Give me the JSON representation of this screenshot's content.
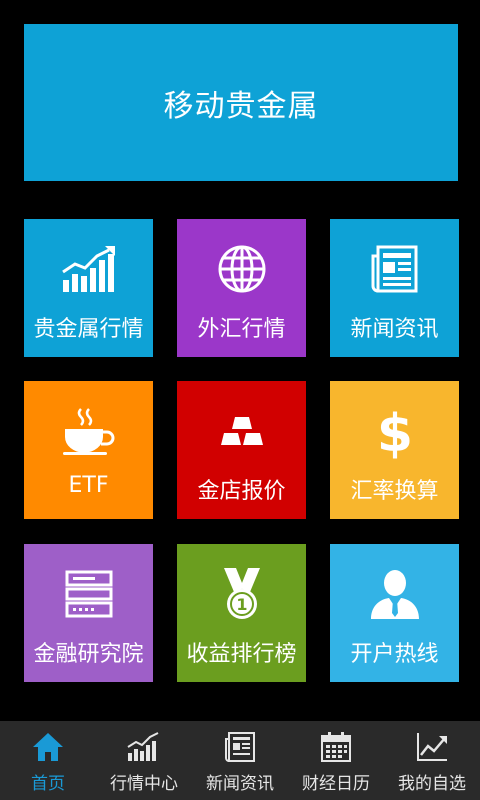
{
  "banner": {
    "title": "移动贵金属"
  },
  "tiles": [
    {
      "label": "贵金属行情",
      "icon": "bar-chart-trend-icon",
      "color": "#0ea2d6"
    },
    {
      "label": "外汇行情",
      "icon": "globe-icon",
      "color": "#9b37c9"
    },
    {
      "label": "新闻资讯",
      "icon": "newspaper-icon",
      "color": "#0ea2d6"
    },
    {
      "label": "ETF",
      "icon": "coffee-cup-icon",
      "color": "#ff8a00"
    },
    {
      "label": "金店报价",
      "icon": "gold-bars-icon",
      "color": "#d10000"
    },
    {
      "label": "汇率换算",
      "icon": "dollar-sign-icon",
      "color": "#f8b62d"
    },
    {
      "label": "金融研究院",
      "icon": "server-icon",
      "color": "#9e5fc8"
    },
    {
      "label": "收益排行榜",
      "icon": "medal-icon",
      "color": "#6b9e1f"
    },
    {
      "label": "开户热线",
      "icon": "person-icon",
      "color": "#33b3e6"
    }
  ],
  "nav": {
    "active_color": "#1a9ad6",
    "items": [
      {
        "label": "首页",
        "icon": "home-icon"
      },
      {
        "label": "行情中心",
        "icon": "market-chart-icon"
      },
      {
        "label": "新闻资讯",
        "icon": "newspaper-icon"
      },
      {
        "label": "财经日历",
        "icon": "calendar-icon"
      },
      {
        "label": "我的自选",
        "icon": "trend-line-icon"
      }
    ]
  }
}
